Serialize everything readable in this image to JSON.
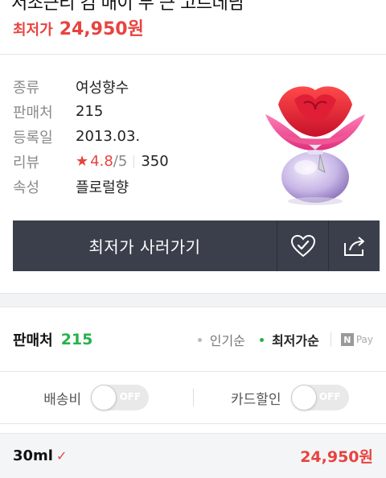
{
  "header": {
    "title_cut": "서조근리 김 매이 두 근 고르데님",
    "price_label": "최저가",
    "price_value": "24,950원"
  },
  "info": {
    "rows": [
      {
        "key": "종류",
        "value": "여성향수"
      },
      {
        "key": "판매처",
        "value": "215"
      },
      {
        "key": "등록일",
        "value": "2013.03."
      },
      {
        "key": "리뷰",
        "star": "★",
        "rating": "4.8",
        "rating_max": "/5",
        "count": "350"
      },
      {
        "key": "속성",
        "value": "플로럴향"
      }
    ]
  },
  "buy": {
    "button_label": "최저가 사러가기"
  },
  "icons": {
    "wish": "heart-check-icon",
    "share": "share-icon"
  },
  "seller": {
    "title": "판매처",
    "count": "215",
    "sort_popular": "인기순",
    "sort_lowest": "최저가순",
    "npay_n": "N",
    "npay_text": "Pay"
  },
  "filters": {
    "shipping_label": "배송비",
    "card_label": "카드할인",
    "toggle_off": "OFF"
  },
  "option": {
    "name": "30ml",
    "check": "✓",
    "price": "24,950원"
  },
  "colors": {
    "accent_red": "#e8433f",
    "accent_green": "#25b24a",
    "button_dark": "#3b3f4c"
  }
}
